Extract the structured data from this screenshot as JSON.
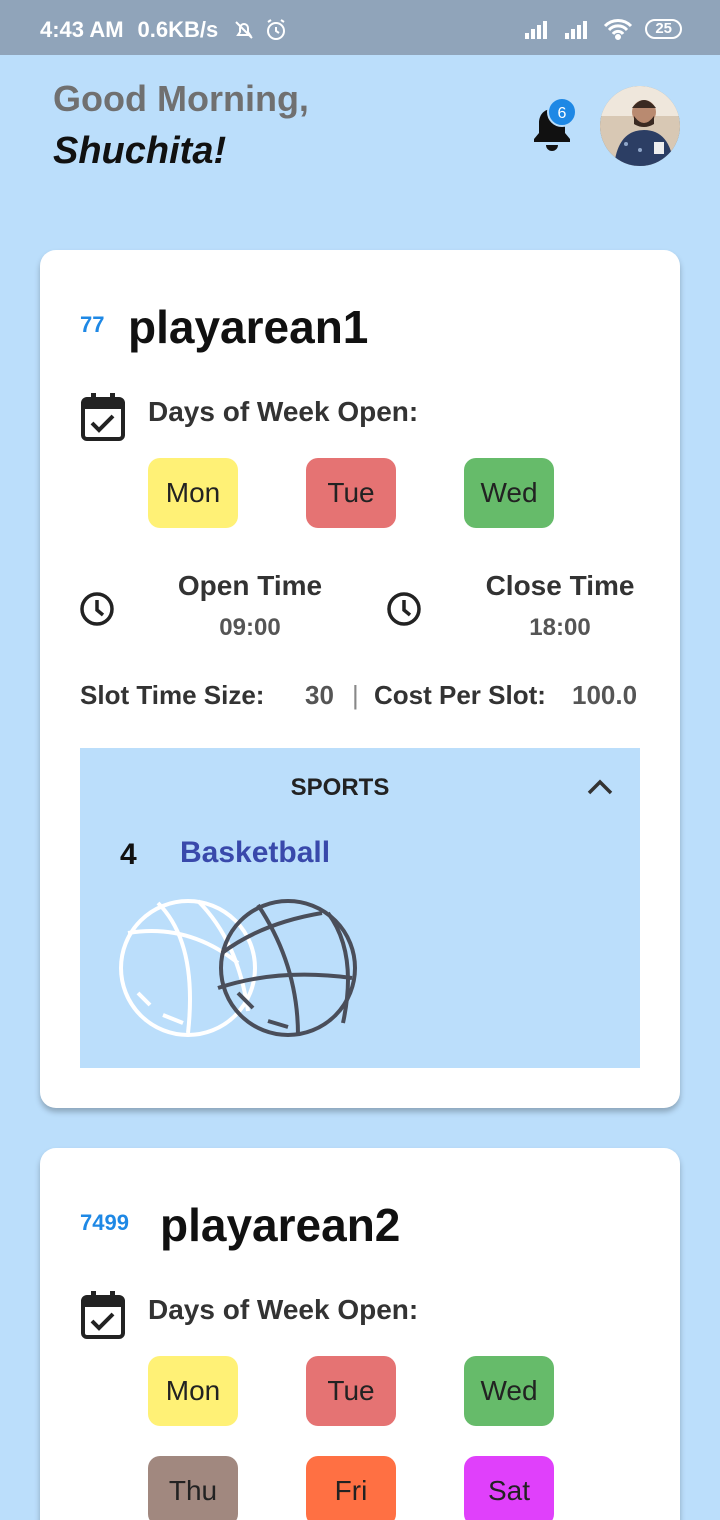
{
  "status_bar": {
    "time": "4:43 AM",
    "speed": "0.6KB/s",
    "battery": "25"
  },
  "header": {
    "greeting": "Good Morning,",
    "name": "Shuchita!",
    "notification_count": "6"
  },
  "labels": {
    "days_open": "Days of Week Open:",
    "open_time": "Open Time",
    "close_time": "Close Time",
    "slot_time_size": "Slot Time Size:",
    "separator": "|",
    "cost_per_slot": "Cost Per Slot:",
    "sports": "SPORTS"
  },
  "playareas": [
    {
      "id": "77",
      "name": "playarean1",
      "days": [
        "Mon",
        "Tue",
        "Wed"
      ],
      "open_time": "09:00",
      "close_time": "18:00",
      "slot_size": "30",
      "cost": "100.0",
      "sport": {
        "count": "4",
        "name": "Basketball"
      }
    },
    {
      "id": "7499",
      "name": "playarean2",
      "days": [
        "Mon",
        "Tue",
        "Wed",
        "Thu",
        "Fri",
        "Sat"
      ]
    }
  ],
  "colors": {
    "background": "#bbdefb",
    "mon": "#fff176",
    "tue": "#e57373",
    "wed": "#66bb6a",
    "thu": "#a1887f",
    "fri": "#ff7043",
    "sat": "#e040fb",
    "accent": "#1e88e5",
    "sport_name": "#3949ab"
  },
  "icons": [
    "bell-icon",
    "calendar-check-icon",
    "clock-icon",
    "chevron-up-icon",
    "basketball-icon"
  ]
}
